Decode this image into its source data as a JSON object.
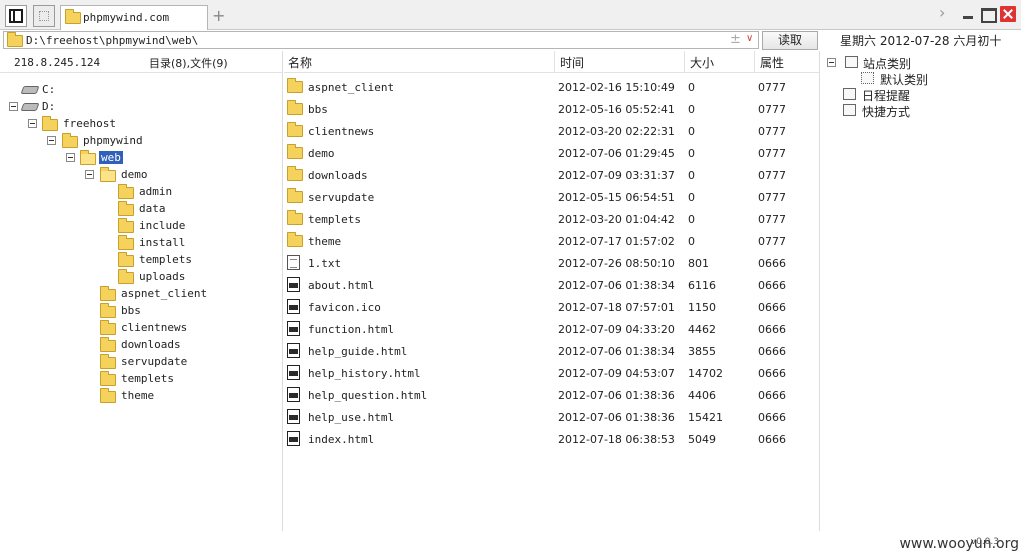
{
  "tab": {
    "title": "phpmywind.com",
    "add": "+"
  },
  "address": {
    "path": "D:\\freehost\\phpmywind\\web\\",
    "plus": "±",
    "dropdown": "∨",
    "read_button": "读取"
  },
  "date": "星期六 2012-07-28 六月初十",
  "left": {
    "ip": "218.8.245.124",
    "counts": "目录(8),文件(9)"
  },
  "tree": [
    {
      "label": "C:",
      "type": "drive"
    },
    {
      "label": "D:",
      "type": "drive"
    },
    {
      "label": "freehost",
      "type": "folder"
    },
    {
      "label": "phpmywind",
      "type": "folder"
    },
    {
      "label": "web",
      "type": "folder"
    },
    {
      "label": "demo",
      "type": "folder"
    },
    {
      "label": "admin",
      "type": "folder"
    },
    {
      "label": "data",
      "type": "folder"
    },
    {
      "label": "include",
      "type": "folder"
    },
    {
      "label": "install",
      "type": "folder"
    },
    {
      "label": "templets",
      "type": "folder"
    },
    {
      "label": "uploads",
      "type": "folder"
    },
    {
      "label": "aspnet_client",
      "type": "folder"
    },
    {
      "label": "bbs",
      "type": "folder"
    },
    {
      "label": "clientnews",
      "type": "folder"
    },
    {
      "label": "downloads",
      "type": "folder"
    },
    {
      "label": "servupdate",
      "type": "folder"
    },
    {
      "label": "templets",
      "type": "folder"
    },
    {
      "label": "theme",
      "type": "folder"
    }
  ],
  "list": {
    "headers": {
      "name": "名称",
      "time": "时间",
      "size": "大小",
      "attr": "属性"
    },
    "rows": [
      {
        "name": "aspnet_client",
        "time": "2012-02-16 15:10:49",
        "size": "0",
        "attr": "0777",
        "type": "folder"
      },
      {
        "name": "bbs",
        "time": "2012-05-16 05:52:41",
        "size": "0",
        "attr": "0777",
        "type": "folder"
      },
      {
        "name": "clientnews",
        "time": "2012-03-20 02:22:31",
        "size": "0",
        "attr": "0777",
        "type": "folder"
      },
      {
        "name": "demo",
        "time": "2012-07-06 01:29:45",
        "size": "0",
        "attr": "0777",
        "type": "folder"
      },
      {
        "name": "downloads",
        "time": "2012-07-09 03:31:37",
        "size": "0",
        "attr": "0777",
        "type": "folder"
      },
      {
        "name": "servupdate",
        "time": "2012-05-15 06:54:51",
        "size": "0",
        "attr": "0777",
        "type": "folder"
      },
      {
        "name": "templets",
        "time": "2012-03-20 01:04:42",
        "size": "0",
        "attr": "0777",
        "type": "folder"
      },
      {
        "name": "theme",
        "time": "2012-07-17 01:57:02",
        "size": "0",
        "attr": "0777",
        "type": "folder"
      },
      {
        "name": "1.txt",
        "time": "2012-07-26 08:50:10",
        "size": "801",
        "attr": "0666",
        "type": "txt"
      },
      {
        "name": "about.html",
        "time": "2012-07-06 01:38:34",
        "size": "6116",
        "attr": "0666",
        "type": "html"
      },
      {
        "name": "favicon.ico",
        "time": "2012-07-18 07:57:01",
        "size": "1150",
        "attr": "0666",
        "type": "html"
      },
      {
        "name": "function.html",
        "time": "2012-07-09 04:33:20",
        "size": "4462",
        "attr": "0666",
        "type": "html"
      },
      {
        "name": "help_guide.html",
        "time": "2012-07-06 01:38:34",
        "size": "3855",
        "attr": "0666",
        "type": "html"
      },
      {
        "name": "help_history.html",
        "time": "2012-07-09 04:53:07",
        "size": "14702",
        "attr": "0666",
        "type": "html"
      },
      {
        "name": "help_question.html",
        "time": "2012-07-06 01:38:36",
        "size": "4406",
        "attr": "0666",
        "type": "html"
      },
      {
        "name": "help_use.html",
        "time": "2012-07-06 01:38:36",
        "size": "15421",
        "attr": "0666",
        "type": "html"
      },
      {
        "name": "index.html",
        "time": "2012-07-18 06:38:53",
        "size": "5049",
        "attr": "0666",
        "type": "html"
      }
    ]
  },
  "right": {
    "site_category": "站点类别",
    "default_category": "默认类别",
    "schedule": "日程提醒",
    "shortcut": "快捷方式"
  },
  "footer": {
    "watermark": "www.wooyun.org",
    "version": "v0.0.3"
  }
}
